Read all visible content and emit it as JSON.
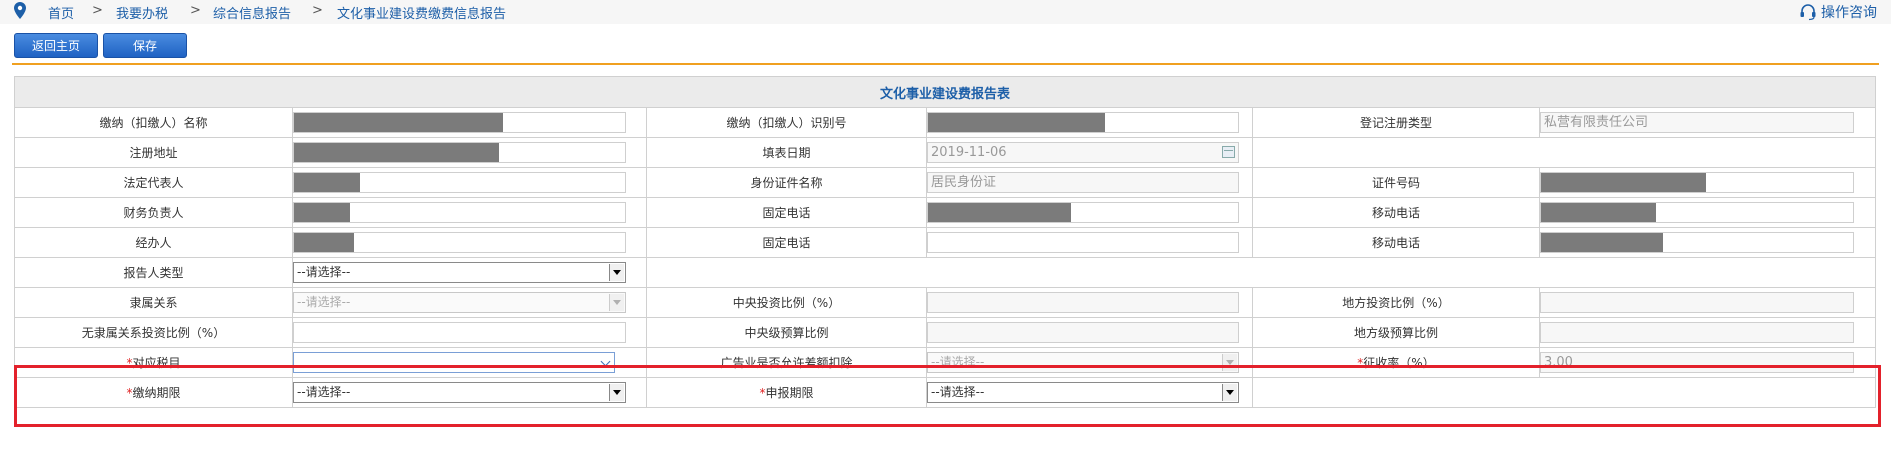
{
  "breadcrumb": [
    "首页",
    "我要办税",
    "综合信息报告",
    "文化事业建设费缴费信息报告"
  ],
  "breadcrumb_separator": ">",
  "help_label": "操作咨询",
  "buttons": {
    "home": "返回主页",
    "save": "保存"
  },
  "form": {
    "title": "文化事业建设费报告表",
    "labels": {
      "payer_name": "缴纳（扣缴人）名称",
      "payer_id": "缴纳（扣缴人）识别号",
      "reg_type": "登记注册类型",
      "reg_address": "注册地址",
      "fill_date": "填表日期",
      "legal_rep": "法定代表人",
      "id_doc_name": "身份证件名称",
      "id_number": "证件号码",
      "finance_head": "财务负责人",
      "fixed_phone": "固定电话",
      "mobile_phone": "移动电话",
      "handler": "经办人",
      "reporter_type": "报告人类型",
      "affiliation": "隶属关系",
      "central_invest_ratio": "中央投资比例（%）",
      "local_invest_ratio": "地方投资比例（%）",
      "no_affil_invest_ratio": "无隶属关系投资比例（%）",
      "central_budget_ratio": "中央级预算比例",
      "local_budget_ratio": "地方级预算比例",
      "tax_item": "对应税目",
      "ad_deduction": "广告业是否允许差额扣除",
      "levy_rate": "征收率（%）",
      "pay_period": "缴纳期限",
      "report_period": "申报期限"
    },
    "required_mark": "*",
    "values": {
      "reg_type": "私营有限责任公司",
      "fill_date": "2019-11-06",
      "id_doc_name": "居民身份证",
      "levy_rate": "3.00",
      "select_placeholder": "--请选择--"
    },
    "masked_fractions": {
      "payer_name": 0.63,
      "payer_id": 0.57,
      "reg_address": 0.62,
      "legal_rep": 0.2,
      "id_number": 0.53,
      "finance_head": 0.17,
      "fixed_phone": 0.46,
      "mobile_phone": 0.37,
      "handler": 0.18,
      "mobile_phone_2": 0.39
    }
  },
  "colors": {
    "accent": "#1d5fa8",
    "highlight": "#e3212b",
    "divider": "#f0a020"
  }
}
